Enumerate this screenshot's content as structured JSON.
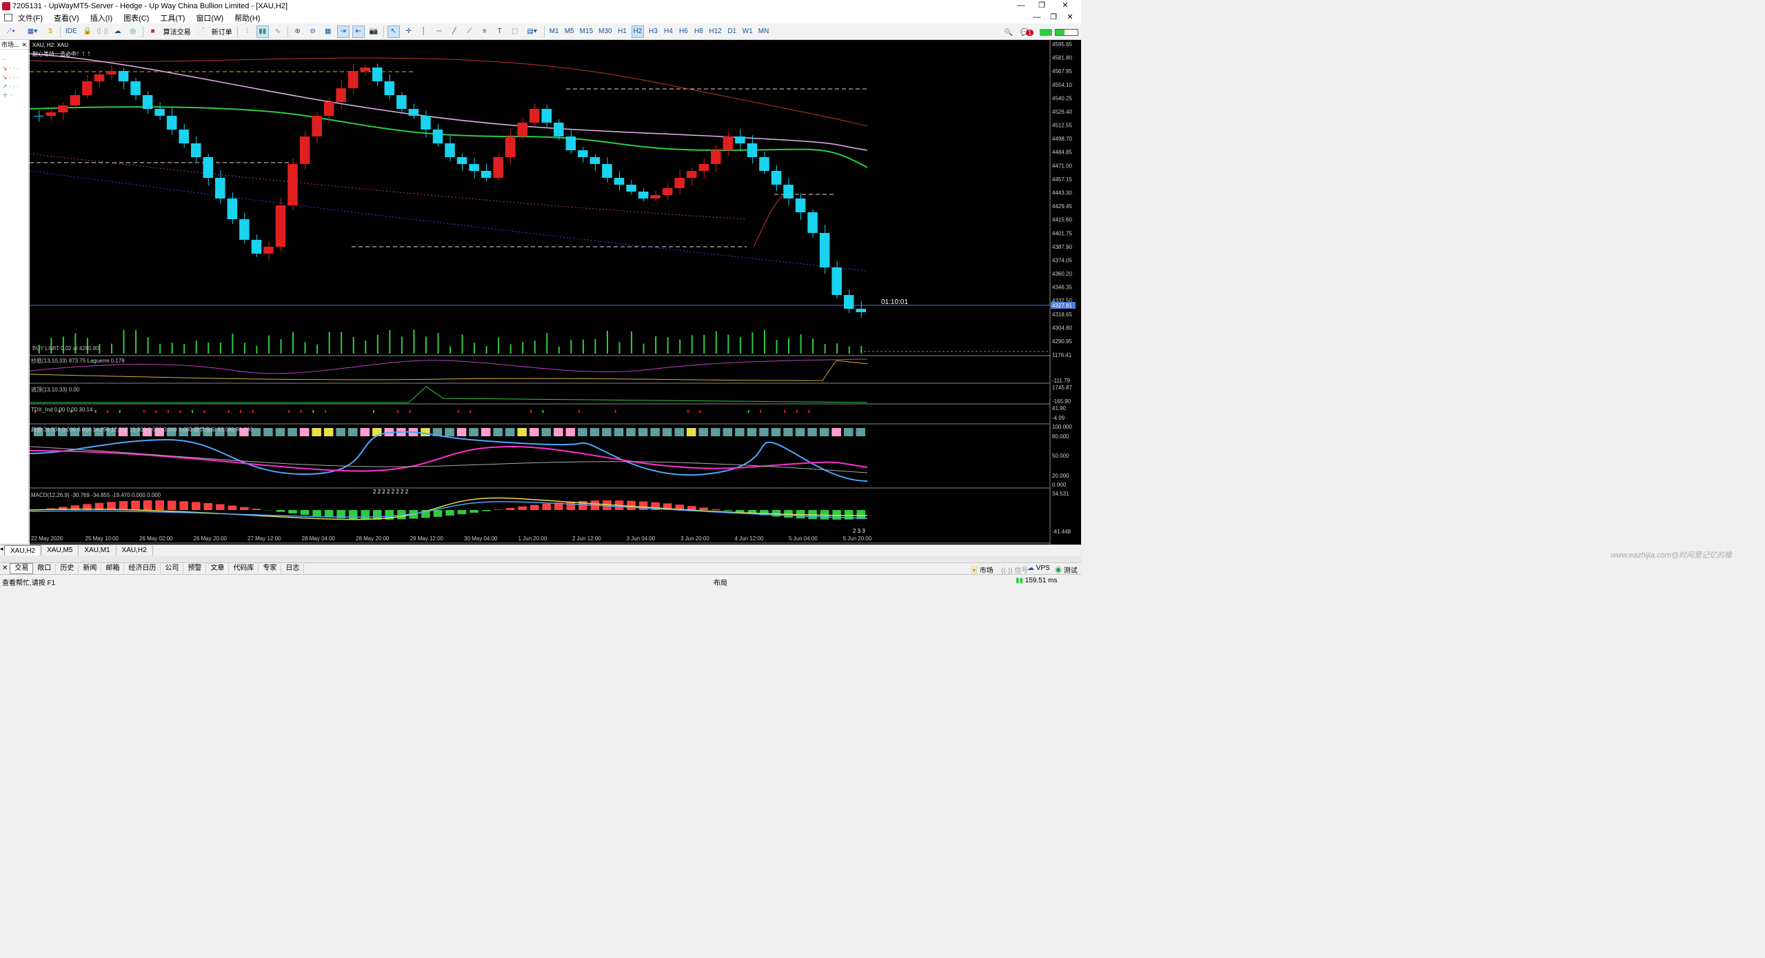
{
  "window": {
    "title": "7205131 - UpWayMT5-Server - Hedge - Up Way China Bullion Limited - [XAU,H2]"
  },
  "menu": {
    "items": [
      "文件(F)",
      "查看(V)",
      "插入(I)",
      "图表(C)",
      "工具(T)",
      "窗口(W)",
      "帮助(H)"
    ]
  },
  "toolbar": {
    "ide": "IDE",
    "algo": "算法交易",
    "neworder": "新订单",
    "timeframes": [
      "M1",
      "M5",
      "M15",
      "M30",
      "H1",
      "H2",
      "H3",
      "H4",
      "H6",
      "H8",
      "H12",
      "D1",
      "W1",
      "MN"
    ],
    "active_tf": "H2",
    "notif_count": "1"
  },
  "market_watch": {
    "title": "市场..."
  },
  "chart": {
    "symbol_label": "XAU, H2:  XAU",
    "comment": "耐心等待一击必中！！！",
    "order_label": "BUY LIMIT 0.02 at 4280.80",
    "countdown": "01:10:01",
    "current_price": "4327.81",
    "price_ticks": [
      "4595.65",
      "4581.80",
      "4567.95",
      "4554.10",
      "4540.25",
      "4526.40",
      "4512.55",
      "4498.70",
      "4484.85",
      "4471.00",
      "4457.15",
      "4443.30",
      "4429.45",
      "4415.60",
      "4401.75",
      "4387.90",
      "4374.05",
      "4360.20",
      "4346.35",
      "4332.50",
      "4318.65",
      "4304.80",
      "4290.95"
    ],
    "x_ticks": [
      "22 May 2026",
      "25 May 10:00",
      "26 May 02:00",
      "26 May 20:00",
      "27 May 12:00",
      "28 May 04:00",
      "28 May 20:00",
      "29 May 12:00",
      "30 May 04:00",
      "1 Jun 20:00",
      "2 Jun 12:00",
      "3 Jun 04:00",
      "3 Jun 20:00",
      "4 Jun 12:00",
      "5 Jun 04:00",
      "5 Jun 20:00"
    ],
    "panes": [
      {
        "label": "抄底(13,10,33) 873.75 Laguerre 0.178",
        "top": "1176.41",
        "bottom": "-111.79"
      },
      {
        "label": "逃顶(13,10,33) 0.00",
        "top": "1745.87",
        "bottom": "-165.90"
      },
      {
        "label": "TDX_Ind 0.00 0.00 30.14",
        "top": "41.90",
        "bottom": "-4.09"
      },
      {
        "label": "趋势 31.538 0.000 0.000 14.296 12.282 19.301 0.000 0.000 0.000 转势指标 93.080 80.000",
        "ticks": [
          "100.000",
          "80.000",
          "50.000",
          "20.000",
          "0.000"
        ]
      },
      {
        "label": "MACD(12,26,9) -30.769 -34.855 -19.470 0.000 0.000",
        "top": "34.531",
        "bottom": "-41.448"
      }
    ],
    "macd_marks": "2 2 2 2 2 2 2 2",
    "macd_marks_end": "2 3 3"
  },
  "chart_tabs": [
    "XAU,H2",
    "XAU,M5",
    "XAU,M1",
    "XAU,H2"
  ],
  "watermark": "www.eazhijia.com@时间是记忆的橡",
  "bottom_tabs": [
    "交易",
    "敞口",
    "历史",
    "新闻",
    "邮箱",
    "经济日历",
    "公司",
    "预警",
    "文章",
    "代码库",
    "专家",
    "日志"
  ],
  "bottom_right": {
    "market": "市场",
    "signal": "信号",
    "vps": "VPS",
    "test": "测试"
  },
  "status": {
    "help": "查看帮忙,请按 F1",
    "layout": "布局",
    "ping": "159.51 ms"
  }
}
